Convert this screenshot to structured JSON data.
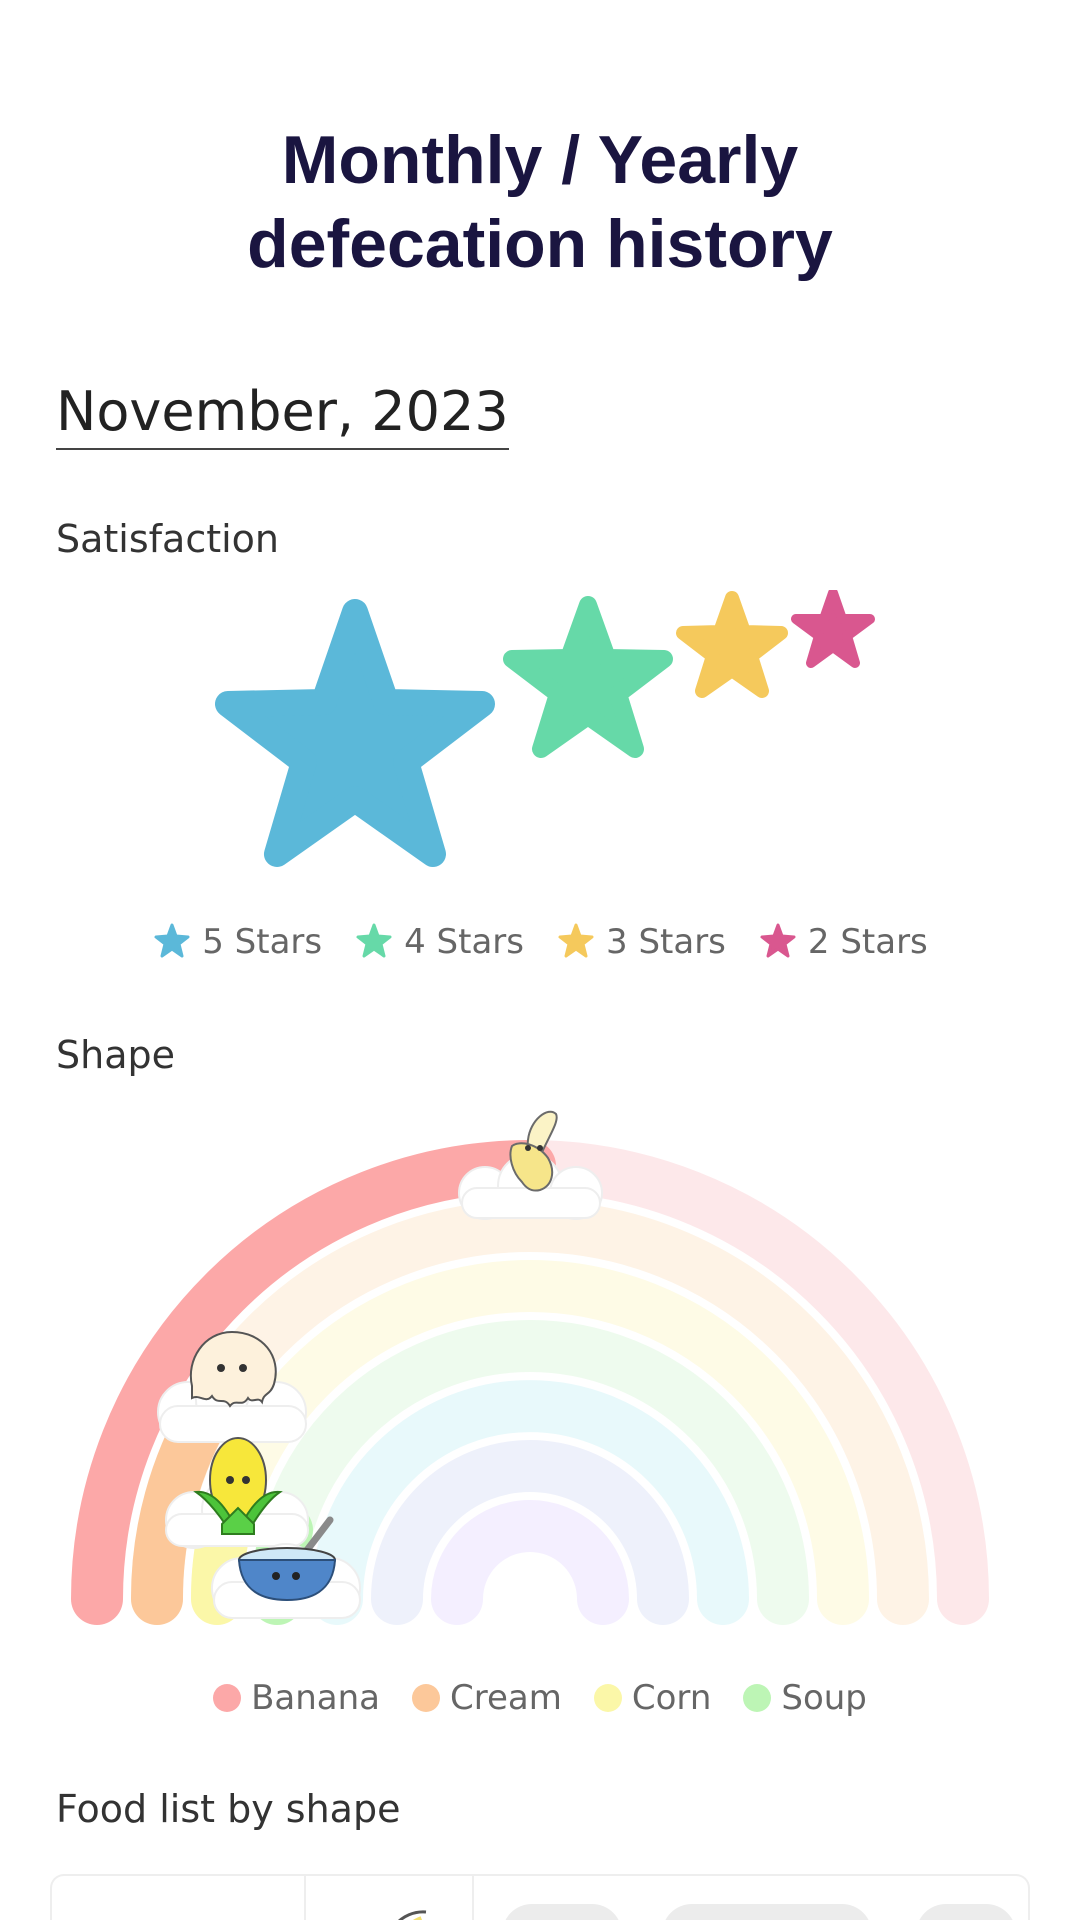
{
  "header": {
    "title_line1": "Monthly / Yearly",
    "title_line2": "defecation history"
  },
  "period": "November, 2023",
  "satisfaction": {
    "label": "Satisfaction",
    "legend": [
      {
        "label": "5 Stars",
        "color": "#5bb8d9"
      },
      {
        "label": "4 Stars",
        "color": "#66d9a8"
      },
      {
        "label": "3 Stars",
        "color": "#f5c95c"
      },
      {
        "label": "2 Stars",
        "color": "#d9578f"
      }
    ]
  },
  "shape": {
    "label": "Shape",
    "legend": [
      {
        "label": "Banana",
        "color": "#fca8a8",
        "icon": "banana-character-icon"
      },
      {
        "label": "Cream",
        "color": "#fcc89a",
        "icon": "ice-cream-character-icon"
      },
      {
        "label": "Corn",
        "color": "#fbf7a8",
        "icon": "corn-character-icon"
      },
      {
        "label": "Soup",
        "color": "#bdf5b5",
        "icon": "soup-bowl-character-icon"
      }
    ],
    "faded_band_colors": [
      "#fde8ea",
      "#fef3e6",
      "#fefbe6",
      "#eefbee",
      "#e8f9fb",
      "#eef1fb",
      "#f4efff",
      "#ffffff"
    ]
  },
  "food_list": {
    "label": "Food list by shape"
  }
}
